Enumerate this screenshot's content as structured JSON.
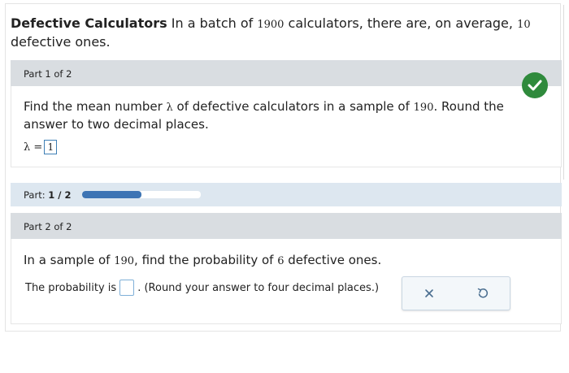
{
  "problem": {
    "title": "Defective Calculators",
    "text_1": " In a batch of ",
    "batch_size": "1900",
    "text_2": " calculators, there are, on average, ",
    "defect_avg": "10",
    "text_3": " defective ones."
  },
  "part1": {
    "header": "Part 1 of 2",
    "q_1": "Find the mean number ",
    "symbol": "λ",
    "q_2": " of defective calculators in a sample of ",
    "sample": "190",
    "q_3": ". Round the answer to two decimal places.",
    "answer_label": "λ =",
    "answer_value": "1",
    "status": "correct"
  },
  "progress": {
    "label": "Part: ",
    "value_text": "1 / 2",
    "fraction": 0.5
  },
  "part2": {
    "header": "Part 2 of 2",
    "q_1": "In a sample of ",
    "sample": "190",
    "q_2": ", find the probability of ",
    "count": "6",
    "q_3": " defective ones.",
    "prob_prefix": "The probability is",
    "prob_suffix": ". (Round your answer to four decimal places.)",
    "answer_value": ""
  },
  "tools": {
    "clear_icon": "x-icon",
    "undo_icon": "undo-icon"
  },
  "colors": {
    "correct": "#2f8a3c",
    "progress": "#3d74b4",
    "part_header": "#d9dde1"
  }
}
